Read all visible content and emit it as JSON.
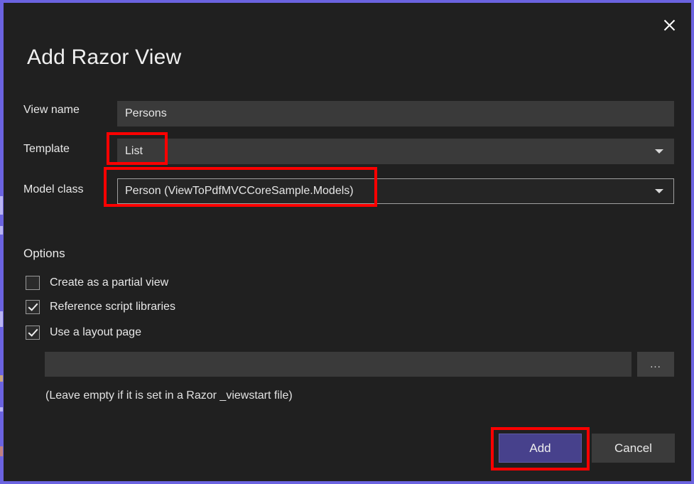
{
  "window": {
    "accent_color": "#6b63e0",
    "background_color": "#202020",
    "close_icon": "close-icon"
  },
  "dialog": {
    "title": "Add Razor View"
  },
  "form": {
    "view_name": {
      "label": "View name",
      "value": "Persons",
      "placeholder": ""
    },
    "template": {
      "label": "Template",
      "value": "List",
      "dropdown_icon": "chevron-down-icon"
    },
    "model_class": {
      "label": "Model class",
      "value": "Person (ViewToPdfMVCCoreSample.Models)",
      "dropdown_icon": "chevron-down-icon"
    }
  },
  "options": {
    "title": "Options",
    "items": [
      {
        "label": "Create as a partial view",
        "checked": false
      },
      {
        "label": "Reference script libraries",
        "checked": true
      },
      {
        "label": "Use a layout page",
        "checked": true
      }
    ]
  },
  "layout_page": {
    "value": "",
    "placeholder": "",
    "browse_label": "...",
    "hint": "(Leave empty if it is set in a Razor _viewstart file)"
  },
  "footer": {
    "add_label": "Add",
    "cancel_label": "Cancel"
  },
  "annotations": {
    "highlight_color": "#fe0000",
    "boxes": [
      {
        "name": "template-value-highlight"
      },
      {
        "name": "model-class-highlight"
      },
      {
        "name": "add-button-highlight"
      }
    ]
  }
}
